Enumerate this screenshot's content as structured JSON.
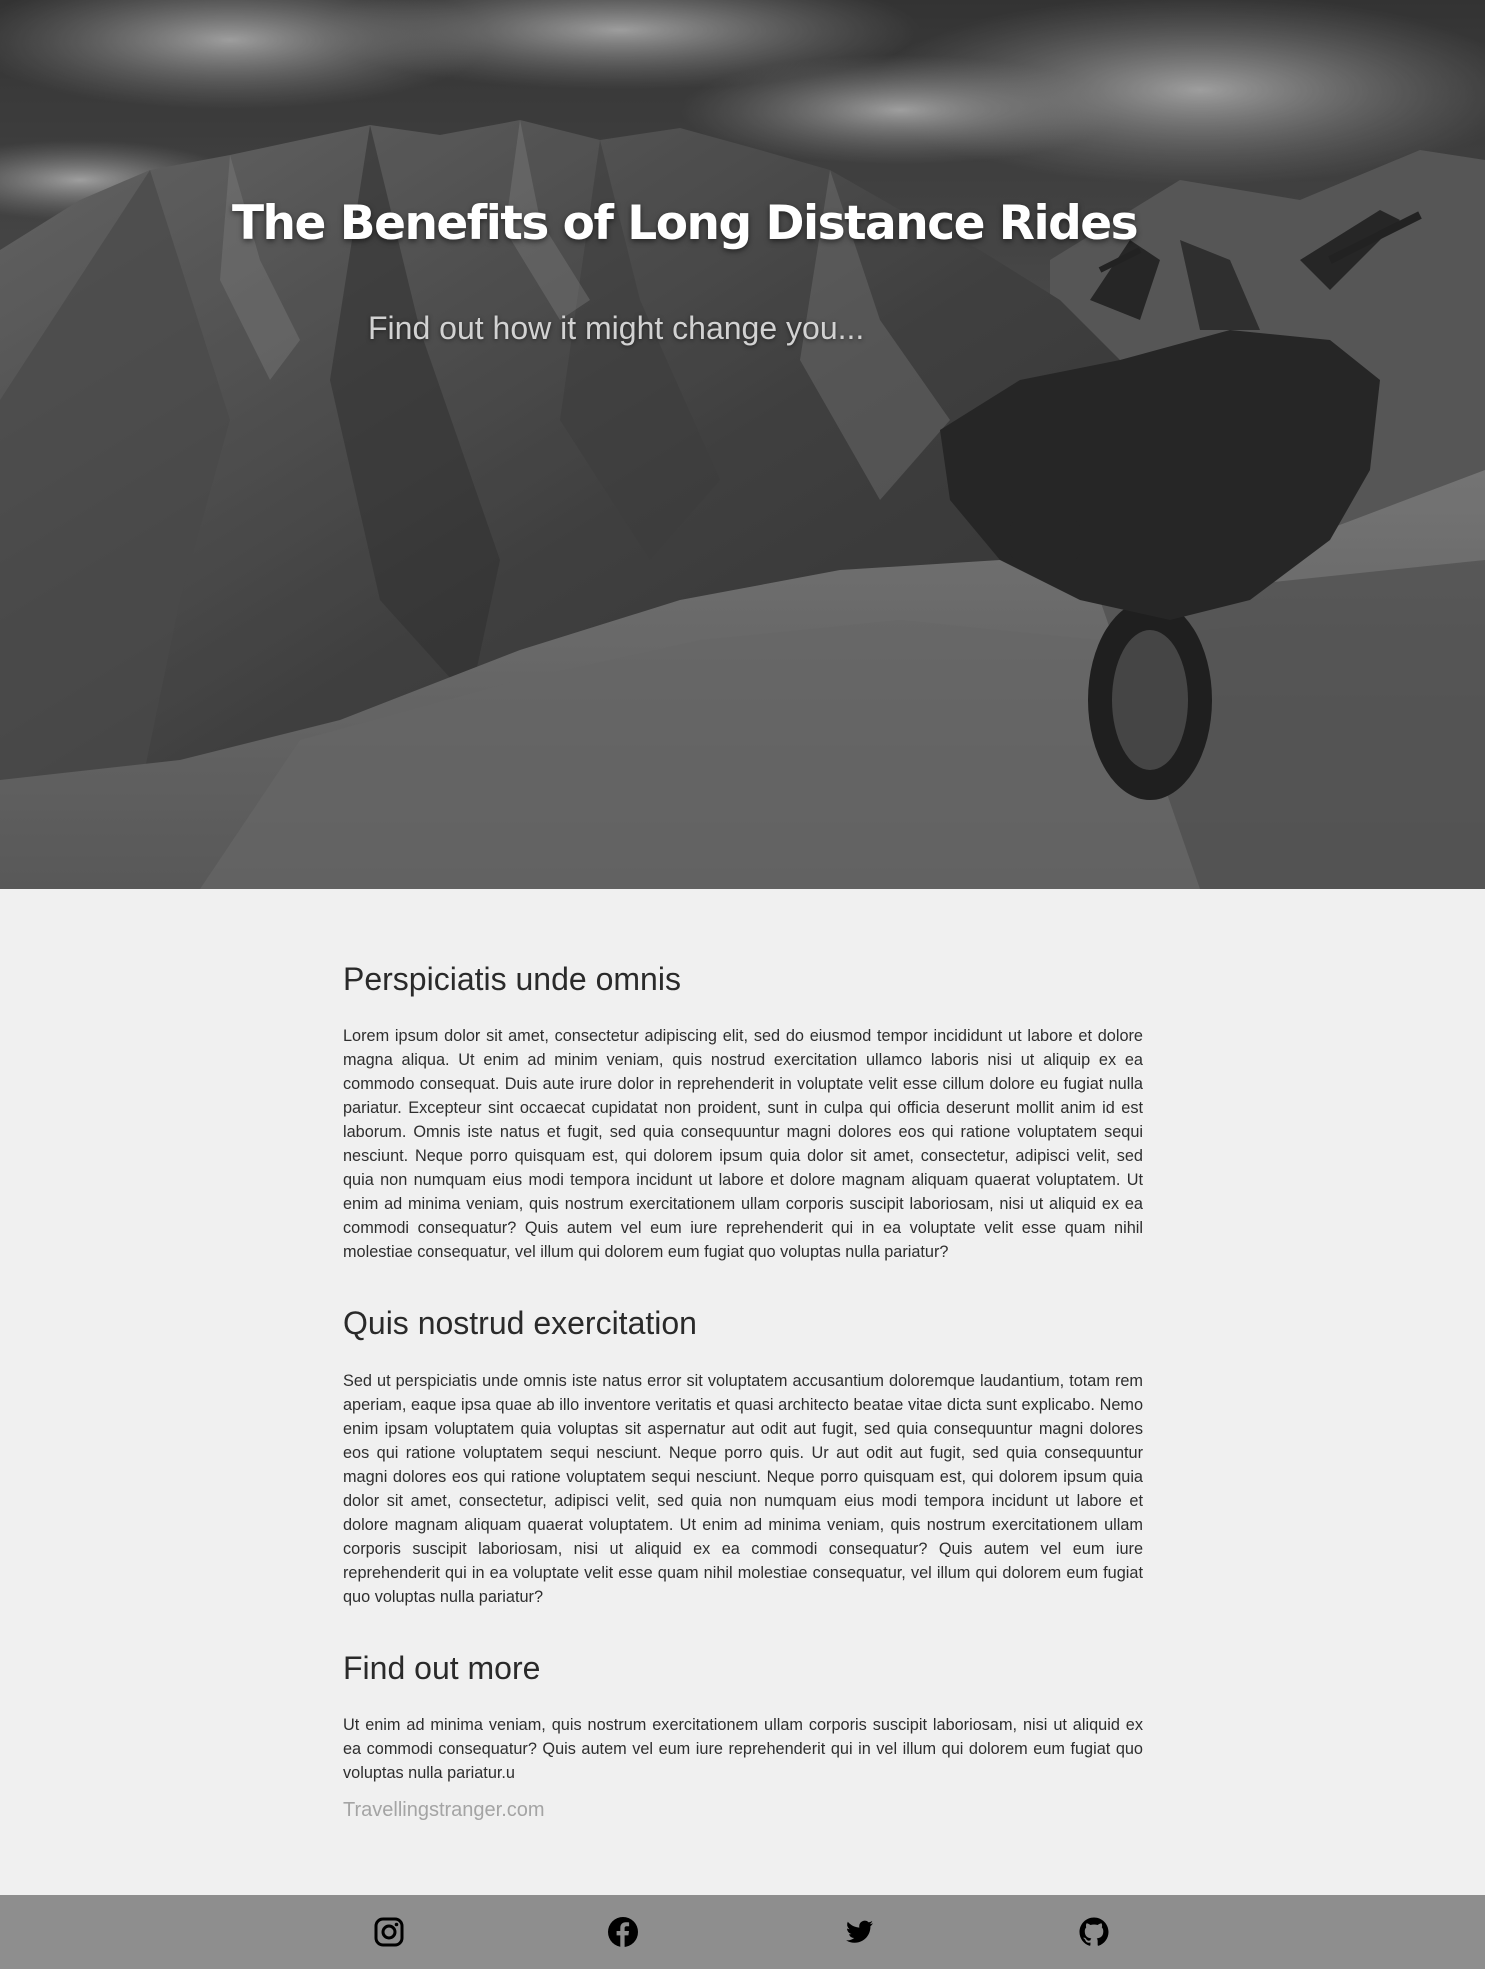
{
  "hero": {
    "title": "The Benefits of Long Distance Rides",
    "subtitle": "Find out how it might change you..."
  },
  "article": {
    "sections": [
      {
        "heading": "Perspiciatis unde omnis",
        "body": "Lorem ipsum dolor sit amet, consectetur adipiscing elit, sed do eiusmod tempor incididunt ut labore et dolore magna aliqua. Ut enim ad minim veniam, quis nostrud exercitation ullamco laboris nisi ut aliquip ex ea commodo consequat. Duis aute irure dolor in reprehenderit in voluptate velit esse cillum dolore eu fugiat nulla pariatur. Excepteur sint occaecat cupidatat non proident, sunt in culpa qui officia deserunt mollit anim id est laborum. Omnis iste natus et fugit, sed quia consequuntur magni dolores eos qui ratione voluptatem sequi nesciunt. Neque porro quisquam est, qui dolorem ipsum quia dolor sit amet, consectetur, adipisci velit, sed quia non numquam eius modi tempora incidunt ut labore et dolore magnam aliquam quaerat voluptatem. Ut enim ad minima veniam, quis nostrum exercitationem ullam corporis suscipit laboriosam, nisi ut aliquid ex ea commodi consequatur? Quis autem vel eum iure reprehenderit qui in ea voluptate velit esse quam nihil molestiae consequatur, vel illum qui dolorem eum fugiat quo voluptas nulla pariatur?"
      },
      {
        "heading": "Quis nostrud exercitation",
        "body": "Sed ut perspiciatis unde omnis iste natus error sit voluptatem accusantium doloremque laudantium, totam rem aperiam, eaque ipsa quae ab illo inventore veritatis et quasi architecto beatae vitae dicta sunt explicabo. Nemo enim ipsam voluptatem quia voluptas sit aspernatur aut odit aut fugit, sed quia consequuntur magni dolores eos qui ratione voluptatem sequi nesciunt. Neque porro quis. Ur aut odit aut fugit, sed quia consequuntur magni dolores eos qui ratione voluptatem sequi nesciunt. Neque porro quisquam est, qui dolorem ipsum quia dolor sit amet, consectetur, adipisci velit, sed quia non numquam eius modi tempora incidunt ut labore et dolore magnam aliquam quaerat voluptatem. Ut enim ad minima veniam, quis nostrum exercitationem ullam corporis suscipit laboriosam, nisi ut aliquid ex ea commodi consequatur? Quis autem vel eum iure reprehenderit qui in ea voluptate velit esse quam nihil molestiae consequatur, vel illum qui dolorem eum fugiat quo voluptas nulla pariatur?"
      },
      {
        "heading": "Find out more",
        "body": "Ut enim ad minima veniam, quis nostrum exercitationem ullam corporis suscipit laboriosam, nisi ut aliquid ex ea commodi consequatur? Quis autem vel eum iure reprehenderit qui in vel illum qui dolorem eum fugiat quo voluptas nulla pariatur.u"
      }
    ],
    "site_link": "Travellingstranger.com"
  },
  "footer": {
    "icons": [
      "instagram-icon",
      "facebook-icon",
      "twitter-icon",
      "github-icon"
    ]
  },
  "colors": {
    "page_background": "#f0f0f0",
    "footer_background": "#8e8e8e",
    "heading_text": "#2a2a2a",
    "link_text": "#a4a4a4"
  }
}
